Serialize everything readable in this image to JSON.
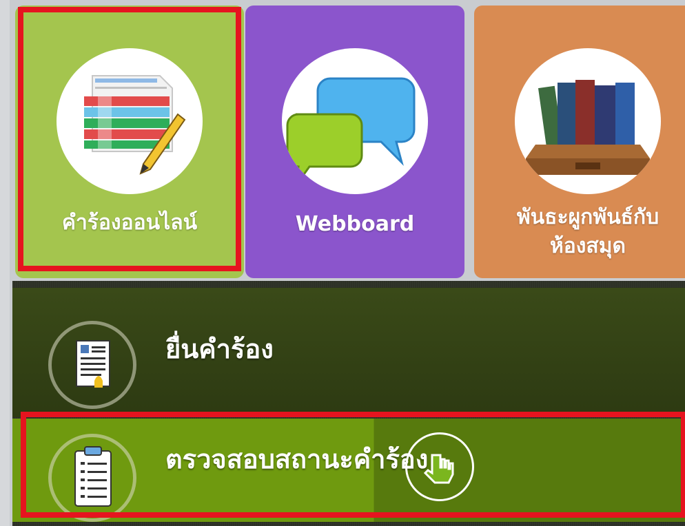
{
  "tiles": [
    {
      "label": "คำร้องออนไลน์",
      "icon": "online-request-form-icon",
      "color": "#a4c54e"
    },
    {
      "label": "Webboard",
      "icon": "chat-bubbles-icon",
      "color": "#8b55cc"
    },
    {
      "label_line1": "พันธะผูกพันธ์กับ",
      "label_line2": "ห้องสมุด",
      "icon": "library-books-icon",
      "color": "#d98b52"
    }
  ],
  "menu": {
    "submit": {
      "label": "ยื่นคำร้อง",
      "icon": "document-submit-icon"
    },
    "check": {
      "label": "ตรวจสอบสถานะคำร้อง",
      "icon": "clipboard-checklist-icon"
    }
  },
  "highlight_color": "#e6141f"
}
